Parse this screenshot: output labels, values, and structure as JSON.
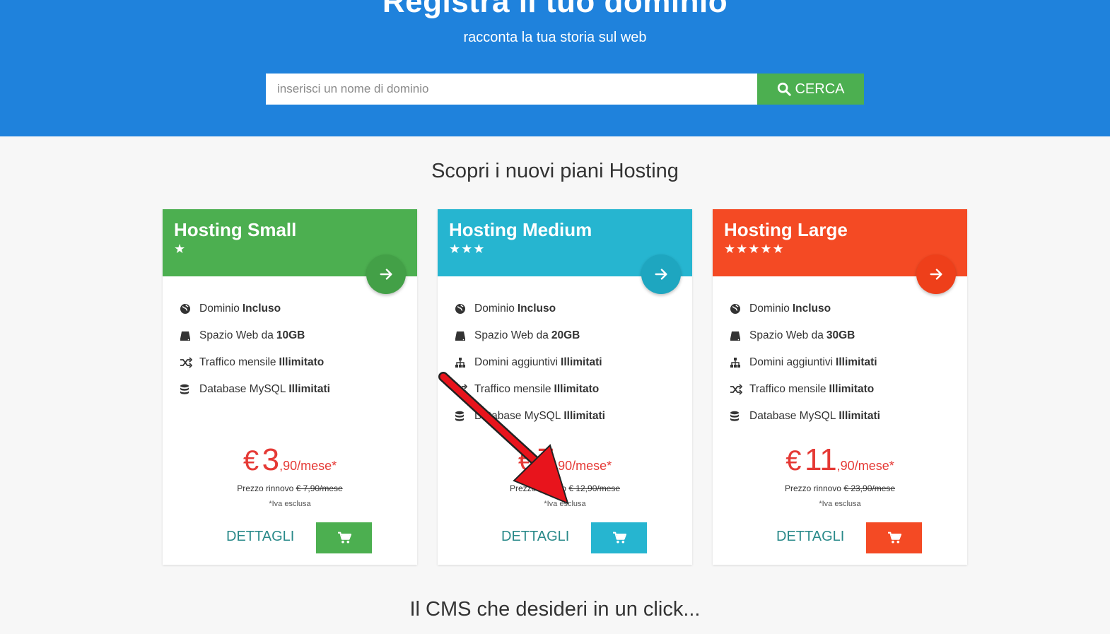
{
  "hero": {
    "title": "Registra il tuo dominio",
    "subtitle": "racconta la tua storia sul web",
    "search_placeholder": "inserisci un nome di dominio",
    "search_button": "CERCA"
  },
  "section_title": "Scopri i nuovi piani Hosting",
  "cms_title": "Il CMS che desideri in un click...",
  "colors": {
    "hero": "#1f82dc",
    "small": "#4caf50",
    "medium": "#26b5d0",
    "large": "#f44a24",
    "price": "#e53935"
  },
  "plans": [
    {
      "name": "Hosting Small",
      "stars": "★",
      "features": [
        {
          "icon": "globe-icon",
          "text": "Dominio",
          "bold": "Incluso"
        },
        {
          "icon": "hdd-icon",
          "text": "Spazio Web da",
          "bold": "10GB"
        },
        {
          "icon": "shuffle-icon",
          "text": "Traffico mensile",
          "bold": "Illimitato"
        },
        {
          "icon": "database-icon",
          "text": "Database MySQL",
          "bold": "Illimitati"
        }
      ],
      "currency": "€",
      "price_int": "3",
      "price_suffix": ",90/mese*",
      "renew_label": "Prezzo rinnovo",
      "renew_price": "€ 7,90/mese",
      "iva": "*Iva esclusa",
      "details": "DETTAGLI"
    },
    {
      "name": "Hosting Medium",
      "stars": "★★★",
      "features": [
        {
          "icon": "globe-icon",
          "text": "Dominio",
          "bold": "Incluso"
        },
        {
          "icon": "hdd-icon",
          "text": "Spazio Web da",
          "bold": "20GB"
        },
        {
          "icon": "sitemap-icon",
          "text": "Domini aggiuntivi",
          "bold": "Illimitati"
        },
        {
          "icon": "shuffle-icon",
          "text": "Traffico mensile",
          "bold": "Illimitato"
        },
        {
          "icon": "database-icon",
          "text": "Database MySQL",
          "bold": "Illimitati"
        }
      ],
      "currency": "€",
      "price_int": "7",
      "price_suffix": ",90/mese*",
      "renew_label": "Prezzo rinnovo",
      "renew_price": "€ 12,90/mese",
      "iva": "*Iva esclusa",
      "details": "DETTAGLI"
    },
    {
      "name": "Hosting Large",
      "stars": "★★★★★",
      "features": [
        {
          "icon": "globe-icon",
          "text": "Dominio",
          "bold": "Incluso"
        },
        {
          "icon": "hdd-icon",
          "text": "Spazio Web da",
          "bold": "30GB"
        },
        {
          "icon": "sitemap-icon",
          "text": "Domini aggiuntivi",
          "bold": "Illimitati"
        },
        {
          "icon": "shuffle-icon",
          "text": "Traffico mensile",
          "bold": "Illimitato"
        },
        {
          "icon": "database-icon",
          "text": "Database MySQL",
          "bold": "Illimitati"
        }
      ],
      "currency": "€",
      "price_int": "11",
      "price_suffix": ",90/mese*",
      "renew_label": "Prezzo rinnovo",
      "renew_price": "€ 23,90/mese",
      "iva": "*Iva esclusa",
      "details": "DETTAGLI"
    }
  ]
}
